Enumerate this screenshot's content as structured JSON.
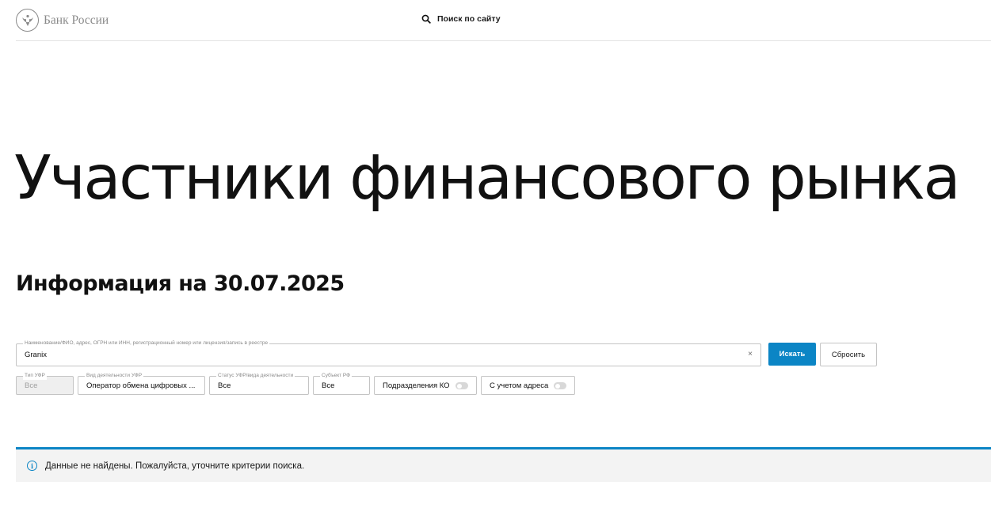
{
  "header": {
    "logo_text": "Банк России",
    "search_label": "Поиск по сайту"
  },
  "page": {
    "title": "Участники финансового рынка",
    "subtitle": "Информация на 30.07.2025"
  },
  "search_form": {
    "main_field": {
      "legend": "Наименование/ФИО, адрес, ОГРН или ИНН, регистрационный номер или лицензия/запись в реестре",
      "value": "Granix",
      "clear_symbol": "×"
    },
    "search_button": "Искать",
    "reset_button": "Сбросить",
    "filters": {
      "type": {
        "legend": "Тип УФР",
        "value": "Все",
        "disabled": true
      },
      "activity": {
        "legend": "Вид деятельности УФР",
        "value": "Оператор обмена цифровых ..."
      },
      "status": {
        "legend": "Статус УФР/вида деятельности",
        "value": "Все"
      },
      "subject": {
        "legend": "Субъект РФ",
        "value": "Все"
      }
    },
    "toggles": {
      "branches": {
        "label": "Подразделения КО",
        "on": false
      },
      "address": {
        "label": "С учетом адреса",
        "on": false
      }
    }
  },
  "result": {
    "icon": "info-icon",
    "message": "Данные не найдены. Пожалуйста, уточните критерии поиска."
  },
  "colors": {
    "accent": "#0b85c5",
    "notice_bg": "#f3f3f3",
    "logo_gray": "#8a8a8a"
  }
}
